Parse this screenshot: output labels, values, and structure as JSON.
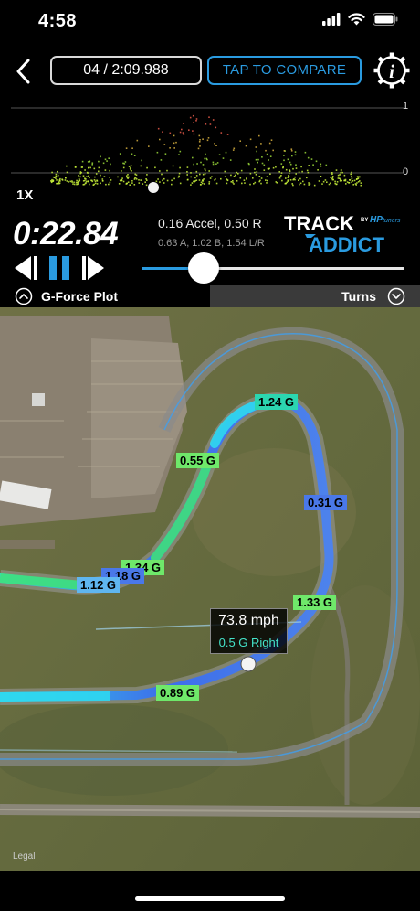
{
  "status_bar": {
    "time": "4:58",
    "icons": [
      "signal-icon",
      "wifi-icon",
      "battery-icon"
    ]
  },
  "nav": {
    "back_icon": "chevron-left-icon",
    "lap_selector": "04 / 2:09.988",
    "compare_button": "TAP TO COMPARE",
    "info_icon": "info-gear-icon"
  },
  "plot": {
    "axis_top": "1",
    "axis_bottom": "0",
    "speed_multiplier": "1X"
  },
  "telemetry": {
    "elapsed": "0:22.84",
    "accel_main": "0.16 Accel, 0.50 R",
    "accel_sub": "0.63 A, 1.02 B, 1.54 L/R",
    "progress": 0.21
  },
  "logo": {
    "track": "TRACK",
    "addict": "ADDICT",
    "by": "BY",
    "brand": "HP",
    "brand_sub": "tuners"
  },
  "panels": {
    "left_label": "G-Force Plot",
    "right_label": "Turns"
  },
  "map": {
    "legal": "Legal",
    "popup_speed": "73.8 mph",
    "popup_g": "0.5 G Right",
    "g_labels": [
      {
        "text": "1.24 G",
        "color": "#2bd6b0"
      },
      {
        "text": "0.55 G",
        "color": "#6fe86a"
      },
      {
        "text": "0.31 G",
        "color": "#4a78e8"
      },
      {
        "text": "1.34 G",
        "color": "#6fe86a"
      },
      {
        "text": "1.18 G",
        "color": "#4a78e8"
      },
      {
        "text": "1.12 G",
        "color": "#5fb6f0"
      },
      {
        "text": "1.33 G",
        "color": "#6fe86a"
      },
      {
        "text": "0.89 G",
        "color": "#6fe86a"
      }
    ]
  },
  "colors": {
    "accent": "#2a9be0",
    "popup_text": "#44e3c9",
    "track_blue": "#3a6df0",
    "track_cyan": "#2fd8f0",
    "track_green": "#3fe07a"
  }
}
